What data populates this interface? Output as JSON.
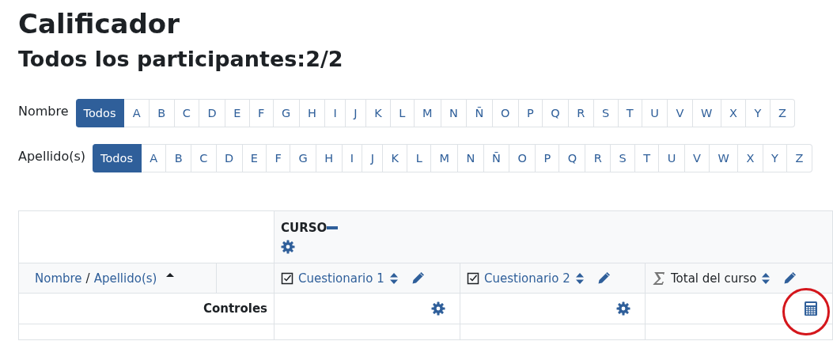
{
  "page_title": "Calificador",
  "subtitle": "Todos los participantes:2/2",
  "filters": [
    {
      "label": "Nombre",
      "items": [
        {
          "text": "Todos",
          "selected": true
        },
        {
          "text": "A",
          "selected": false
        },
        {
          "text": "B",
          "selected": false
        },
        {
          "text": "C",
          "selected": false
        },
        {
          "text": "D",
          "selected": false
        },
        {
          "text": "E",
          "selected": false
        },
        {
          "text": "F",
          "selected": false
        },
        {
          "text": "G",
          "selected": false
        },
        {
          "text": "H",
          "selected": false
        },
        {
          "text": "I",
          "selected": false
        },
        {
          "text": "J",
          "selected": false
        },
        {
          "text": "K",
          "selected": false
        },
        {
          "text": "L",
          "selected": false
        },
        {
          "text": "M",
          "selected": false
        },
        {
          "text": "N",
          "selected": false
        },
        {
          "text": "Ñ",
          "selected": false
        },
        {
          "text": "O",
          "selected": false
        },
        {
          "text": "P",
          "selected": false
        },
        {
          "text": "Q",
          "selected": false
        },
        {
          "text": "R",
          "selected": false
        },
        {
          "text": "S",
          "selected": false
        },
        {
          "text": "T",
          "selected": false
        },
        {
          "text": "U",
          "selected": false
        },
        {
          "text": "V",
          "selected": false
        },
        {
          "text": "W",
          "selected": false
        },
        {
          "text": "X",
          "selected": false
        },
        {
          "text": "Y",
          "selected": false
        },
        {
          "text": "Z",
          "selected": false
        }
      ]
    },
    {
      "label": "Apellido(s)",
      "items": [
        {
          "text": "Todos",
          "selected": true
        },
        {
          "text": "A",
          "selected": false
        },
        {
          "text": "B",
          "selected": false
        },
        {
          "text": "C",
          "selected": false
        },
        {
          "text": "D",
          "selected": false
        },
        {
          "text": "E",
          "selected": false
        },
        {
          "text": "F",
          "selected": false
        },
        {
          "text": "G",
          "selected": false
        },
        {
          "text": "H",
          "selected": false
        },
        {
          "text": "I",
          "selected": false
        },
        {
          "text": "J",
          "selected": false
        },
        {
          "text": "K",
          "selected": false
        },
        {
          "text": "L",
          "selected": false
        },
        {
          "text": "M",
          "selected": false
        },
        {
          "text": "N",
          "selected": false
        },
        {
          "text": "Ñ",
          "selected": false
        },
        {
          "text": "O",
          "selected": false
        },
        {
          "text": "P",
          "selected": false
        },
        {
          "text": "Q",
          "selected": false
        },
        {
          "text": "R",
          "selected": false
        },
        {
          "text": "S",
          "selected": false
        },
        {
          "text": "T",
          "selected": false
        },
        {
          "text": "U",
          "selected": false
        },
        {
          "text": "V",
          "selected": false
        },
        {
          "text": "W",
          "selected": false
        },
        {
          "text": "X",
          "selected": false
        },
        {
          "text": "Y",
          "selected": false
        },
        {
          "text": "Z",
          "selected": false
        }
      ]
    }
  ],
  "table": {
    "category": "CURSO",
    "name_header": {
      "first": "Nombre",
      "separator": "/",
      "last": "Apellido(s)",
      "sorted_ascending": true
    },
    "grade_items": [
      {
        "kind": "quiz",
        "name": "Cuestionario 1"
      },
      {
        "kind": "quiz",
        "name": "Cuestionario 2"
      },
      {
        "kind": "total",
        "name": "Total del curso"
      }
    ],
    "controls_label": "Controles",
    "controls": [
      {
        "kind": "settings",
        "highlighted": false
      },
      {
        "kind": "settings",
        "highlighted": false
      },
      {
        "kind": "calculation",
        "highlighted": true
      }
    ]
  }
}
